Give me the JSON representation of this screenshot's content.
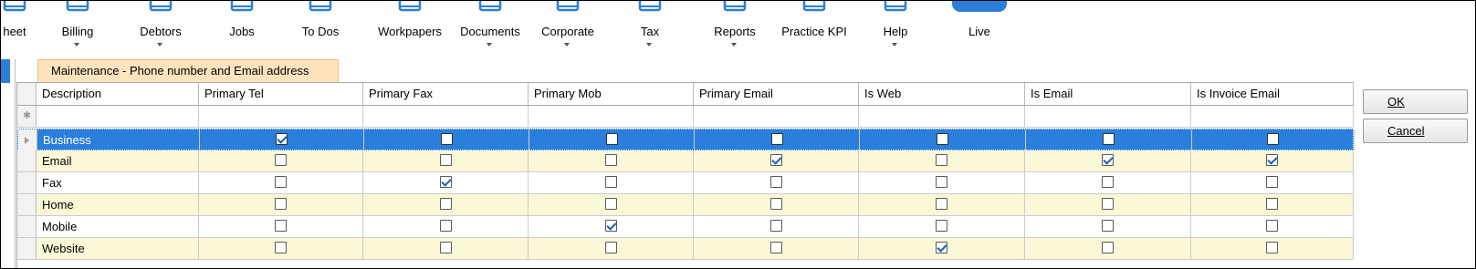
{
  "ribbon": {
    "items": [
      {
        "label": "heet",
        "icon": "timesheet-icon",
        "dropdown": false
      },
      {
        "label": "Billing",
        "icon": "billing-icon",
        "dropdown": true
      },
      {
        "label": "Debtors",
        "icon": "debtors-icon",
        "dropdown": true
      },
      {
        "label": "Jobs",
        "icon": "jobs-icon",
        "dropdown": false
      },
      {
        "label": "To Dos",
        "icon": "todos-icon",
        "dropdown": false
      },
      {
        "label": "Workpapers",
        "icon": "workpapers-icon",
        "dropdown": false
      },
      {
        "label": "Documents",
        "icon": "documents-icon",
        "dropdown": true
      },
      {
        "label": "Corporate",
        "icon": "corporate-icon",
        "dropdown": true
      },
      {
        "label": "Tax",
        "icon": "tax-icon",
        "dropdown": true
      },
      {
        "label": "Reports",
        "icon": "reports-icon",
        "dropdown": true
      },
      {
        "label": "Practice KPI",
        "icon": "kpi-icon",
        "dropdown": false
      },
      {
        "label": "Help",
        "icon": "help-icon",
        "dropdown": true
      },
      {
        "label": "Live",
        "icon": "live-icon",
        "dropdown": false
      }
    ]
  },
  "tab": {
    "label": "Maintenance - Phone number and Email address"
  },
  "grid": {
    "columns": [
      "Description",
      "Primary Tel",
      "Primary Fax",
      "Primary Mob",
      "Primary Email",
      "Is Web",
      "Is Email",
      "Is Invoice Email"
    ],
    "rows": [
      {
        "label": "Business",
        "checks": [
          true,
          false,
          false,
          false,
          false,
          false,
          false
        ],
        "selected": true
      },
      {
        "label": "Email",
        "checks": [
          false,
          false,
          false,
          true,
          false,
          true,
          true
        ]
      },
      {
        "label": "Fax",
        "checks": [
          false,
          true,
          false,
          false,
          false,
          false,
          false
        ]
      },
      {
        "label": "Home",
        "checks": [
          false,
          false,
          false,
          false,
          false,
          false,
          false
        ]
      },
      {
        "label": "Mobile",
        "checks": [
          false,
          false,
          true,
          false,
          false,
          false,
          false
        ]
      },
      {
        "label": "Website",
        "checks": [
          false,
          false,
          false,
          false,
          true,
          false,
          false
        ]
      }
    ]
  },
  "buttons": {
    "ok": "OK",
    "cancel": "Cancel"
  },
  "colors": {
    "selection": "#2a7fdd",
    "alt_row": "#fbf8d7",
    "tab": "#ffe3bd",
    "accent": "#2c7fd6"
  }
}
